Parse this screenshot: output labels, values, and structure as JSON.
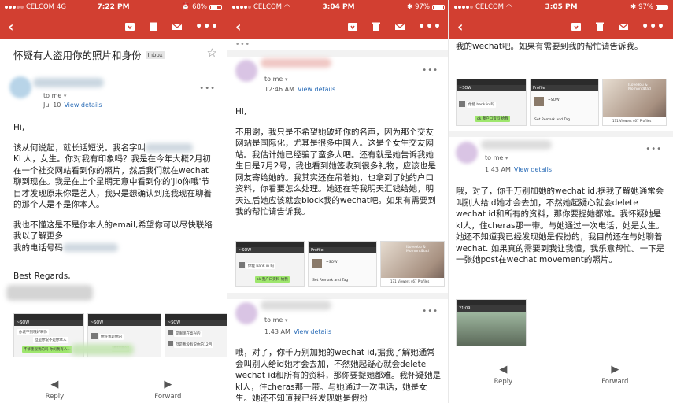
{
  "panels": [
    {
      "status": {
        "carrier": "CELCOM",
        "network": "4G",
        "time": "7:22 PM",
        "battery": "68%",
        "battery_level": 0.68
      },
      "subject": "怀疑有人盗用你的照片和身份",
      "badge": "Inbox",
      "to": "to me",
      "date": "Jul 10",
      "view_details": "View details",
      "body": [
        "Hi,",
        "该从何说起，就长话短说。我名字叫",
        "Kl 人，女生。你对我有印象吗？我是在今年大概2月初在一个社交网站看到你的照片，然后我们就在wechat聊到现在。我是在上个星期无意中看到你的'jio你哦'节目才发现原来你是艺人，我只是想确认到底我现在聊着的那个人是不是你本人。",
        "我也不懂这是不是你本人的email,希望你可以尽快联络我以了解更多",
        "我的电话号码",
        "Best Regards,"
      ],
      "thumbs": [
        {
          "header": "~SOW",
          "lines": [
            "你说不到哦好啊你",
            "但是你说不是你本人",
            "不够重现我的吗 你问我有人..."
          ]
        },
        {
          "header": "~SOW",
          "lines": [
            "你好我是你的",
            "都知道么"
          ]
        },
        {
          "header": "~SOW",
          "lines": [
            "是啊现在高兴的",
            "但是我没有说你的12月"
          ]
        }
      ],
      "reply": "Reply",
      "forward": "Forward"
    },
    {
      "status": {
        "carrier": "CELCOM",
        "time": "3:04 PM",
        "battery": "97%",
        "battery_level": 0.97
      },
      "more": "•••",
      "to": "to me",
      "date": "12:46 AM",
      "view_details": "View details",
      "body": [
        "Hi,",
        "不用谢，我只是不希望她破坏你的名声，因为那个交友网站是国际化，尤其是很多中国人。这是个女生交友网站。我估计她已经骗了蛮多人吧。还有就是她告诉我她生日是7月2号，我也看到她签收到很多礼物，应该也是网友寄给她的。我其实还在吊着她，也拿到了她的户口资料，你看要怎么处理。她还在等我明天汇钱给她，明天过后她应该就会block我的wechat吧。如果有需要到我的帮忙请告诉我。"
      ],
      "thumbs": [
        {
          "header": "~SOW",
          "lines": [
            "你能 bank in 吗",
            "ok 我户口资料 给我"
          ]
        },
        {
          "header": "Profile",
          "lines": [
            "~SOW",
            "Set Remark and Tag"
          ]
        },
        {
          "header": "",
          "lines": [
            "ILoveYou & MomAndDad",
            "171 Viewers 467 Profiles"
          ]
        }
      ],
      "to2": "to me",
      "date2": "1:43 AM",
      "view_details2": "View details",
      "body2": [
        "哦，对了，你千万别加她的wechat id,据我了解她通常会叫别人给id她才会去加，不然她起疑心就会delete wechat id和所有的资料，那你要捉她都难。我怀疑她是kl人，住cheras那一带。与她通过一次电话，她是女生。她还不知道我已经发现她是假扮"
      ]
    },
    {
      "status": {
        "carrier": "CELCOM",
        "time": "3:05 PM",
        "battery": "97%",
        "battery_level": 0.97
      },
      "top_text": "我的wechat吧。如果有需要到我的帮忙请告诉我。",
      "thumbs": [
        {
          "header": "~SOW",
          "lines": [
            "你能 bank in 吗",
            "ok 我户口资料 给我"
          ]
        },
        {
          "header": "Profile",
          "lines": [
            "~SOW",
            "Set Remark and Tag"
          ]
        },
        {
          "header": "",
          "lines": [
            "ILoveYou & MomAndDad",
            "171 Viewers 467 Profiles"
          ]
        }
      ],
      "to": "to me",
      "date": "1:43 AM",
      "view_details": "View details",
      "body": [
        "哦，对了，你千万别加她的wechat id,据我了解她通常会叫别人给id她才会去加，不然她起疑心就会delete wechat id和所有的资料，那你要捉她都难。我怀疑她是kl人，住cheras那一带。与她通过一次电话，她是女生。她还不知道我已经发现她是假扮的，我目前还在与她聊着wechat. 如果真的需要到我让我懂，我乐意帮忙。一下是一张她post在wechat movement的照片。"
      ],
      "moment": {
        "header": "21:09"
      },
      "reply": "Reply",
      "forward": "Forward"
    }
  ]
}
